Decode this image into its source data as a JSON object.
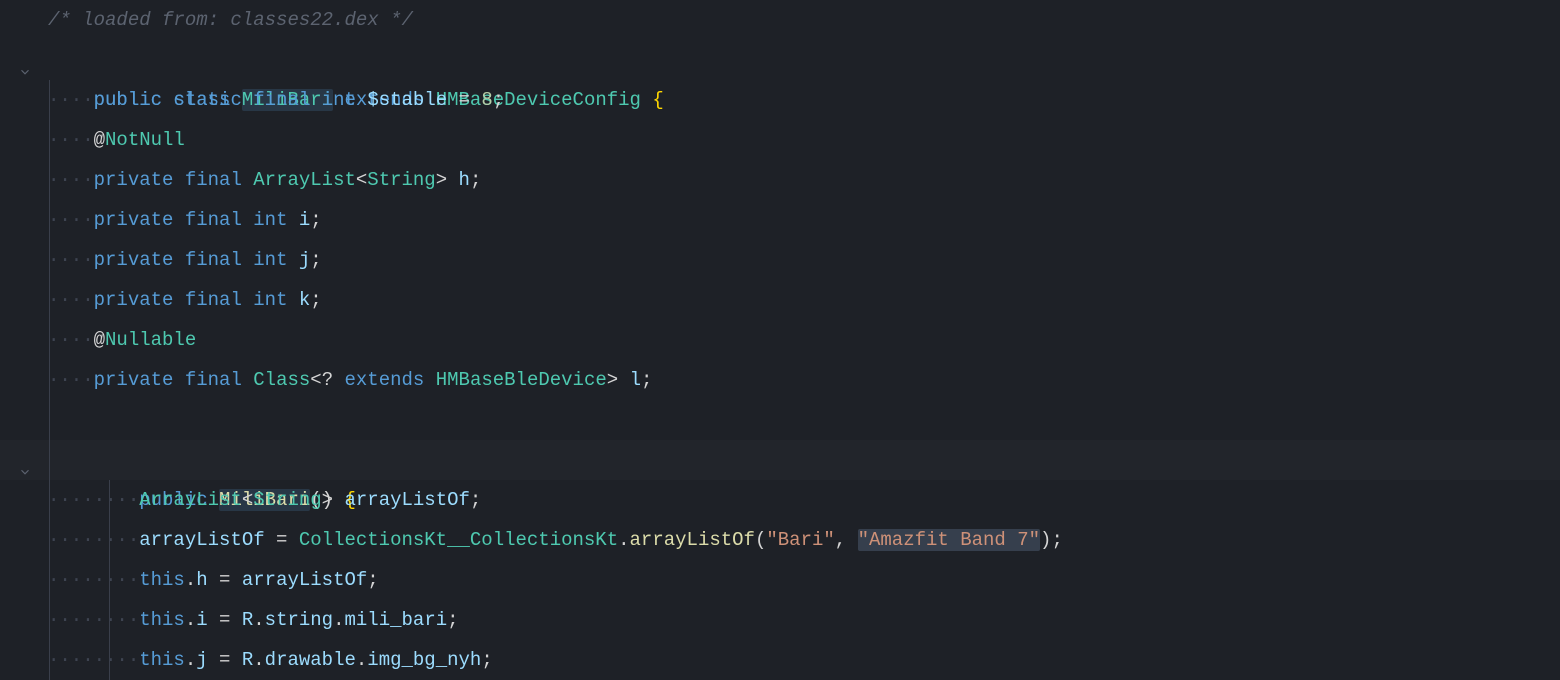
{
  "code": {
    "comment_line": "/* loaded from: classes22.dex */",
    "class_decl": {
      "kw_public": "public",
      "kw_class": "class",
      "name": "MiliBari",
      "kw_extends": "extends",
      "super": "HMBaseDeviceConfig",
      "brace": "{"
    },
    "stable_field": {
      "kw_public": "public",
      "kw_static": "static",
      "kw_final": "final",
      "type": "int",
      "name": "$stable",
      "eq": "=",
      "value": "8",
      "semi": ";"
    },
    "anno_notnull": {
      "at": "@",
      "name": "NotNull"
    },
    "field_h": {
      "kw_private": "private",
      "kw_final": "final",
      "type": "ArrayList",
      "lt": "<",
      "generic": "String",
      "gt": ">",
      "name": "h",
      "semi": ";"
    },
    "field_i": {
      "kw_private": "private",
      "kw_final": "final",
      "type": "int",
      "name": "i",
      "semi": ";"
    },
    "field_j": {
      "kw_private": "private",
      "kw_final": "final",
      "type": "int",
      "name": "j",
      "semi": ";"
    },
    "field_k": {
      "kw_private": "private",
      "kw_final": "final",
      "type": "int",
      "name": "k",
      "semi": ";"
    },
    "anno_nullable": {
      "at": "@",
      "name": "Nullable"
    },
    "field_l": {
      "kw_private": "private",
      "kw_final": "final",
      "type": "Class",
      "lt": "<",
      "wild": "?",
      "kw_extends": "extends",
      "generic": "HMBaseBleDevice",
      "gt": ">",
      "name": "l",
      "semi": ";"
    },
    "ctor": {
      "kw_public": "public",
      "name": "MiliBari",
      "parens": "()",
      "brace": "{"
    },
    "ctor_body": {
      "decl": {
        "type": "ArrayList",
        "lt": "<",
        "generic": "String",
        "gt": ">",
        "name": "arrayListOf",
        "semi": ";"
      },
      "assign1": {
        "lhs": "arrayListOf",
        "eq": "=",
        "cls": "CollectionsKt__CollectionsKt",
        "dot": ".",
        "method": "arrayListOf",
        "lp": "(",
        "str1": "\"Bari\"",
        "comma": ",",
        "str2": "\"Amazfit Band 7\"",
        "rp": ")",
        "semi": ";"
      },
      "assign_h": {
        "this": "this",
        "dot": ".",
        "field": "h",
        "eq": "=",
        "rhs": "arrayListOf",
        "semi": ";"
      },
      "assign_i": {
        "this": "this",
        "dot": ".",
        "field": "i",
        "eq": "=",
        "r": "R",
        "d1": ".",
        "ns": "string",
        "d2": ".",
        "val": "mili_bari",
        "semi": ";"
      },
      "assign_j": {
        "this": "this",
        "dot": ".",
        "field": "j",
        "eq": "=",
        "r": "R",
        "d1": ".",
        "ns": "drawable",
        "d2": ".",
        "val": "img_bg_nyh",
        "semi": ";"
      }
    }
  },
  "dots": {
    "d4": "····",
    "d8": "········",
    "d12": "············"
  }
}
